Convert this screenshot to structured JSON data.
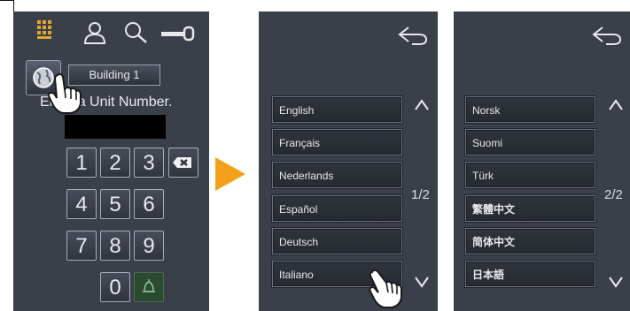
{
  "screen1": {
    "building_label": "Building 1",
    "prompt": "Enter a Unit Number.",
    "keys": [
      "1",
      "2",
      "3",
      "4",
      "5",
      "6",
      "7",
      "8",
      "9",
      "0"
    ]
  },
  "screen2": {
    "languages": [
      "English",
      "Français",
      "Nederlands",
      "Español",
      "Deutsch",
      "Italiano"
    ],
    "page_indicator": "1/2"
  },
  "screen3": {
    "languages": [
      "Norsk",
      "Suomi",
      "Türk",
      "繁體中文",
      "简体中文",
      "日本語"
    ],
    "page_indicator": "2/2"
  },
  "colors": {
    "panel_bg": "#3a3f4a",
    "accent_orange": "#f3a11b",
    "grid_icon_gold": "#e0a92c",
    "bell_green": "#2c4a30"
  },
  "icons": [
    "grid-icon",
    "user-icon",
    "search-icon",
    "key-icon",
    "globe-icon",
    "touch-hand-icon",
    "backspace-icon",
    "bell-icon",
    "back-icon",
    "chevron-up-icon",
    "chevron-down-icon"
  ]
}
